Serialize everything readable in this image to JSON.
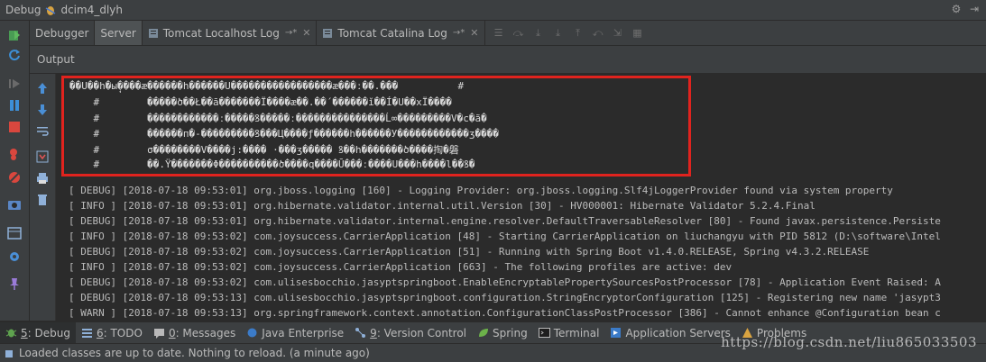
{
  "window": {
    "title": "Debug",
    "config_name": "dcim4_dlyh"
  },
  "tabs": [
    {
      "label": "Debugger"
    },
    {
      "label": "Server"
    },
    {
      "label": "Tomcat Localhost Log",
      "pin": "→*",
      "close": "✕"
    },
    {
      "label": "Tomcat Catalina Log",
      "pin": "→*",
      "close": "✕"
    }
  ],
  "output": {
    "title": "Output"
  },
  "garbled_lines": [
    "��U��h�ы̘����æ������h������U�����������������æ���ː��.���          #",
    "    #        �����ծ��Ł��ā�������Ï����æ��.��´������ǐ��Í�U��xÏ����",
    "    #        ������������ː�����ꝸ�����ː���������������Ĺ∞���������V�c�ã�",
    "    #        ������п�-���������ꝸ���Ц����ƒ������h������У������������ʒ����",
    "    #        σ��������V����j:���� ·���ʒ����� ꝸ��h�������ծ����掏�磐",
    "    #        ��.Ϋ�������Φ����������ծ����q����Ū���ː����U���h����l��ꝸ�"
  ],
  "log_lines": [
    "[ DEBUG] [2018-07-18 09:53:01] org.jboss.logging [160] - Logging Provider: org.jboss.logging.Slf4jLoggerProvider found via system property",
    "[ INFO ] [2018-07-18 09:53:01] org.hibernate.validator.internal.util.Version [30] - HV000001: Hibernate Validator 5.2.4.Final",
    "[ DEBUG] [2018-07-18 09:53:01] org.hibernate.validator.internal.engine.resolver.DefaultTraversableResolver [80] - Found javax.persistence.Persiste",
    "[ INFO ] [2018-07-18 09:53:02] com.joysuccess.CarrierApplication [48] - Starting CarrierApplication on liuchangyu with PID 5812 (D:\\software\\Intel",
    "[ DEBUG] [2018-07-18 09:53:02] com.joysuccess.CarrierApplication [51] - Running with Spring Boot v1.4.0.RELEASE, Spring v4.3.2.RELEASE",
    "[ INFO ] [2018-07-18 09:53:02] com.joysuccess.CarrierApplication [663] - The following profiles are active: dev",
    "[ DEBUG] [2018-07-18 09:53:02] com.ulisesbocchio.jasyptspringboot.EnableEncryptablePropertySourcesPostProcessor [78] - Application Event Raised: A",
    "[ DEBUG] [2018-07-18 09:53:13] com.ulisesbocchio.jasyptspringboot.configuration.StringEncryptorConfiguration [125] - Registering new name 'jasypt3",
    "[ WARN ] [2018-07-18 09:53:13] org.springframework.context.annotation.ConfigurationClassPostProcessor [386] - Cannot enhance @Configuration bean c"
  ],
  "bottom_tools": [
    {
      "key": "5",
      "label": ": Debug",
      "icon": "bug-icon"
    },
    {
      "key": "6",
      "label": ": TODO",
      "icon": "todo-icon"
    },
    {
      "key": "0",
      "label": ": Messages",
      "icon": "messages-icon"
    },
    {
      "key": "",
      "label": "Java Enterprise",
      "icon": "java-enterprise-icon"
    },
    {
      "key": "9",
      "label": ": Version Control",
      "icon": "version-control-icon"
    },
    {
      "key": "",
      "label": "Spring",
      "icon": "spring-icon"
    },
    {
      "key": "",
      "label": "Terminal",
      "icon": "terminal-icon"
    },
    {
      "key": "",
      "label": "Application Servers",
      "icon": "application-servers-icon"
    },
    {
      "key": "",
      "label": "Problems",
      "icon": "problems-icon"
    }
  ],
  "status": {
    "message": "Loaded classes are up to date. Nothing to reload. (a minute ago)"
  },
  "watermark": "https://blog.csdn.net/liu865033503",
  "colors": {
    "highlight_border": "#e0231e",
    "background": "#2b2b2b",
    "panel": "#3c3f41"
  }
}
